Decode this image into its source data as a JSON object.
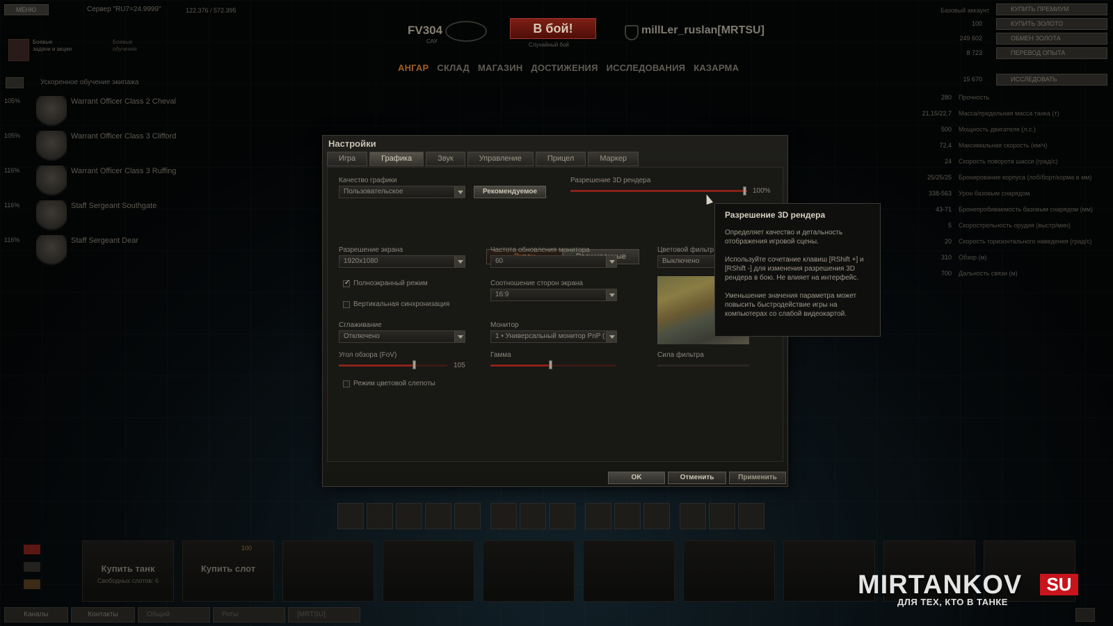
{
  "header": {
    "menu_label": "МЕНЮ",
    "server_label": "Сервер \"RU7=24.9999\"",
    "online_count": "122.376 / 572.395",
    "tank_name": "FV304",
    "tank_type": "САУ",
    "battle_button": "В бой!",
    "battle_mode": "Случайный бой",
    "player_name": "millLer_ruslan[MRTSU]",
    "nav_tabs": [
      "АНГАР",
      "СКЛАД",
      "МАГАЗИН",
      "ДОСТИЖЕНИЯ",
      "ИССЛЕДОВАНИЯ",
      "КАЗАРМА"
    ],
    "tasks_label_1": "Боевые",
    "tasks_label_2": "задачи и акции",
    "tasks2_label_1": "Боевые",
    "tasks2_label_2": "обучение"
  },
  "account": {
    "type_label": "Базовый аккаунт",
    "buy_premium": "КУПИТЬ ПРЕМИУМ",
    "gold": "100",
    "buy_gold": "КУПИТЬ ЗОЛОТО",
    "credits": "249 602",
    "exchange_gold": "ОБМЕН ЗОЛОТА",
    "free_xp": "8 723",
    "transfer_xp": "ПЕРЕВОД ОПЫТА",
    "xp": "15 670",
    "research": "ИССЛЕДОВАТЬ"
  },
  "crew": {
    "header": "Ускоренное обучение экипажа",
    "members": [
      {
        "pct": "105%",
        "name": "Warrant Officer Class 2 Cheval"
      },
      {
        "pct": "105%",
        "name": "Warrant Officer Class 3 Clifford"
      },
      {
        "pct": "116%",
        "name": "Warrant Officer Class 3 Ruffing"
      },
      {
        "pct": "116%",
        "name": "Staff Sergeant Southgate"
      },
      {
        "pct": "116%",
        "name": "Staff Sergeant Dear"
      }
    ]
  },
  "tank_stats": [
    {
      "value": "280",
      "label": "Прочность"
    },
    {
      "value": "21,15/22,7",
      "label": "Масса/предельная масса танка (т)"
    },
    {
      "value": "500",
      "label": "Мощность двигателя (л.с.)"
    },
    {
      "value": "72,4",
      "label": "Максимальная скорость (км/ч)"
    },
    {
      "value": "24",
      "label": "Скорость поворота шасси (град/с)"
    },
    {
      "value": "25/25/25",
      "label": "Бронирование корпуса (лоб/борт/корма в мм)"
    },
    {
      "value": "338-563",
      "label": "Урон базовым снарядом"
    },
    {
      "value": "43-71",
      "label": "Бронепробиваемость базовым снарядом (мм)"
    },
    {
      "value": "5",
      "label": "Скорострельность орудия (выстр/мин)"
    },
    {
      "value": "20",
      "label": "Скорость горизонтального наведения (град/с)"
    },
    {
      "value": "310",
      "label": "Обзор (м)"
    },
    {
      "value": "700",
      "label": "Дальность связи (м)"
    }
  ],
  "settings": {
    "title": "Настройки",
    "tabs": [
      "Игра",
      "Графика",
      "Звук",
      "Управление",
      "Прицел",
      "Маркер"
    ],
    "active_tab": "Графика",
    "quality_label": "Качество графики",
    "quality_value": "Пользовательское",
    "recommended_button": "Рекомендуемое",
    "render_res_label": "Разрешение 3D рендера",
    "render_res_value": "100%",
    "render_res_level": 1.0,
    "subtabs": [
      "Экран",
      "Расширенные"
    ],
    "screen_res_label": "Разрешение экрана",
    "screen_res_value": "1920x1080",
    "refresh_label": "Частота обновления монитора",
    "refresh_value": "60",
    "color_filter_label": "Цветовой фильтр",
    "color_filter_value": "Выключено",
    "fullscreen_label": "Полноэкранный режим",
    "fullscreen_checked": true,
    "vsync_label": "Вертикальная синхронизация",
    "vsync_checked": false,
    "aspect_label": "Соотношение сторон экрана",
    "aspect_value": "16:9",
    "aa_label": "Сглаживание",
    "aa_value": "Отключено",
    "monitor_label": "Монитор",
    "monitor_value": "1 • Универсальный монитор PnP (",
    "fov_label": "Угол обзора (FoV)",
    "fov_value": "105",
    "gamma_label": "Гамма",
    "filter_strength_label": "Сила фильтра",
    "colorblind_label": "Режим цветовой слепоты",
    "ok_button": "OK",
    "cancel_button": "Отменить",
    "apply_button": "Применить"
  },
  "tooltip": {
    "title": "Разрешение 3D рендера",
    "p1": "Определяет качество и детальность отображения игровой сцены.",
    "p2": "Используйте сочетание клавиш [RShift +] и [RShift -] для изменения разрешения 3D рендера в бою. Не влияет на интерфейс.",
    "p3": "Уменьшение значения параметра может повысить быстродействие игры на компьютерах со слабой видеокартой."
  },
  "bottom": {
    "buy_tank": "Купить танк",
    "free_slots": "Свободных слотов: 6",
    "buy_slot": "Купить слот",
    "slot_price": "100",
    "chat_tabs": [
      "Каналы",
      "Контакты",
      "Общий",
      "Роты",
      "[MRTSU]"
    ]
  },
  "watermark": {
    "brand": "MIRTANKOV",
    "tld": "SU",
    "slogan": "ДЛЯ ТЕХ, КТО В ТАНКЕ"
  }
}
